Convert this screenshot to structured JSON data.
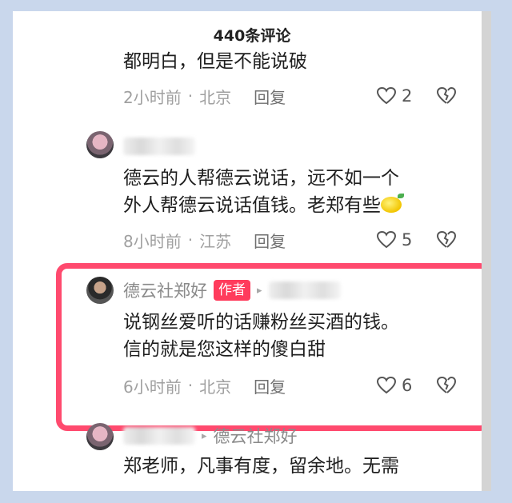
{
  "header": {
    "title": "440条评论"
  },
  "comments": [
    {
      "text": "都明白，但是不能说破",
      "time": "2小时前",
      "location": "北京",
      "reply_label": "回复",
      "likes": "2"
    },
    {
      "text_line1": "德云的人帮德云说话，远不如一个",
      "text_line2": "外人帮德云说话值钱。老郑有些",
      "time": "8小时前",
      "location": "江苏",
      "reply_label": "回复",
      "likes": "5"
    },
    {
      "username": "德云社郑好",
      "author_tag": "作者",
      "text_line1": "说钢丝爱听的话赚粉丝买酒的钱。",
      "text_line2": "信的就是您这样的傻白甜",
      "time": "6小时前",
      "location": "北京",
      "reply_label": "回复",
      "likes": "6"
    },
    {
      "reply_to": "德云社郑好",
      "text_line1": "郑老师，凡事有度，留余地。无需"
    }
  ],
  "colors": {
    "highlight": "#ff4a6e",
    "author_tag": "#ff3b5c"
  }
}
